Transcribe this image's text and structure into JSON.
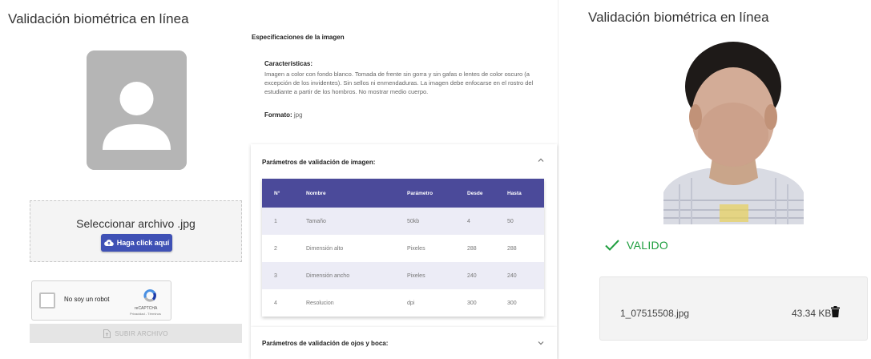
{
  "left": {
    "title": "Validación biométrica en línea",
    "upload": {
      "label": "Seleccionar archivo .jpg",
      "button": "Haga click aquí",
      "icon": "cloud-upload-icon"
    },
    "recaptcha": {
      "label": "No soy un robot",
      "brand": "reCAPTCHA",
      "links": "Privacidad - Términos"
    },
    "submit_button": "SUBIR ARCHIVO",
    "spec_title": "Especificaciones de la imagen",
    "characteristics_title": "Características:",
    "characteristics_text": "Imagen a color con fondo blanco. Tomada de frente sin gorra y sin gafas o lentes de color oscuro (a excepción de los invidentes). Sin sellos ni enmendaduras. La imagen debe enfocarse en el rostro del estudiante a partir de los hombros. No mostrar medio cuerpo.",
    "format_label": "Formato:",
    "format_value": "jpg",
    "params_title": "Parámetros de validación de imagen:",
    "params_table": {
      "headers": [
        "N°",
        "Nombre",
        "Parámetro",
        "Desde",
        "Hasta"
      ],
      "rows": [
        [
          "1",
          "Tamaño",
          "50kb",
          "4",
          "50"
        ],
        [
          "2",
          "Dimensión alto",
          "Pixeles",
          "288",
          "288"
        ],
        [
          "3",
          "Dimensión ancho",
          "Pixeles",
          "240",
          "240"
        ],
        [
          "4",
          "Resolucion",
          "dpi",
          "300",
          "300"
        ]
      ]
    },
    "eyes_title": "Parámetros de validación de ojos y boca:"
  },
  "right": {
    "title": "Validación biométrica en línea",
    "status": "VALIDO",
    "file_name": "1_07515508.jpg",
    "file_size": "43.34 KB"
  },
  "colors": {
    "primary": "#3f51b5",
    "table_header": "#4b4a9a",
    "valid": "#1e9e3e"
  }
}
